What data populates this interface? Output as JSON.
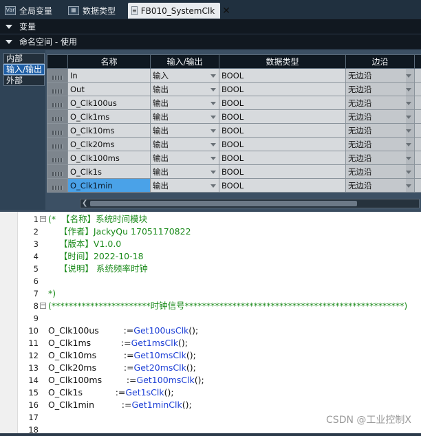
{
  "tabs": [
    {
      "label": "全局变量",
      "icon": "var-icon",
      "icon_text": "Var"
    },
    {
      "label": "数据类型",
      "icon": "data-type-icon",
      "icon_text": "▦"
    },
    {
      "label": "FB010_SystemClk",
      "icon": "fb-icon",
      "icon_text": "≡",
      "active": true
    }
  ],
  "sections": {
    "variables": "变量",
    "namespace": "命名空间 - 使用"
  },
  "scopes": [
    "内部",
    "输入/输出",
    "外部"
  ],
  "table": {
    "headers": [
      "名称",
      "输入/输出",
      "数据类型",
      "边沿"
    ],
    "rows": [
      {
        "name": "In",
        "io": "输入",
        "type": "BOOL",
        "edge": "无边沿"
      },
      {
        "name": "Out",
        "io": "输出",
        "type": "BOOL",
        "edge": "无边沿"
      },
      {
        "name": "O_Clk100us",
        "io": "输出",
        "type": "BOOL",
        "edge": "无边沿"
      },
      {
        "name": "O_Clk1ms",
        "io": "输出",
        "type": "BOOL",
        "edge": "无边沿"
      },
      {
        "name": "O_Clk10ms",
        "io": "输出",
        "type": "BOOL",
        "edge": "无边沿"
      },
      {
        "name": "O_Clk20ms",
        "io": "输出",
        "type": "BOOL",
        "edge": "无边沿"
      },
      {
        "name": "O_Clk100ms",
        "io": "输出",
        "type": "BOOL",
        "edge": "无边沿"
      },
      {
        "name": "O_Clk1s",
        "io": "输出",
        "type": "BOOL",
        "edge": "无边沿"
      },
      {
        "name": "O_Clk1min",
        "io": "输出",
        "type": "BOOL",
        "edge": "无边沿",
        "selected": true
      }
    ]
  },
  "code": {
    "lines": [
      {
        "n": "1",
        "fold": "−",
        "parts": [
          {
            "c": "cmt",
            "t": "(*  【名称】系统时间模块"
          }
        ]
      },
      {
        "n": "2",
        "parts": [
          {
            "c": "cmt",
            "t": "    【作者】JackyQu 17051170822"
          }
        ]
      },
      {
        "n": "3",
        "parts": [
          {
            "c": "cmt",
            "t": "    【版本】V1.0.0"
          }
        ]
      },
      {
        "n": "4",
        "parts": [
          {
            "c": "cmt",
            "t": "    【时间】2022-10-18"
          }
        ]
      },
      {
        "n": "5",
        "parts": [
          {
            "c": "cmt",
            "t": "    【说明】 系统频率时钟"
          }
        ]
      },
      {
        "n": "6",
        "parts": []
      },
      {
        "n": "7",
        "parts": [
          {
            "c": "cmt",
            "t": "*)"
          }
        ]
      },
      {
        "n": "8",
        "fold": "−",
        "parts": [
          {
            "c": "cmt",
            "t": "(***********************时钟信号***************************************************)"
          }
        ]
      },
      {
        "n": "9",
        "parts": []
      },
      {
        "n": "10",
        "parts": [
          {
            "c": "var",
            "t": "O_Clk100us         "
          },
          {
            "c": "op",
            "t": ":="
          },
          {
            "c": "fn",
            "t": "Get100usClk"
          },
          {
            "c": "op",
            "t": "();"
          }
        ]
      },
      {
        "n": "11",
        "parts": [
          {
            "c": "var",
            "t": "O_Clk1ms           "
          },
          {
            "c": "op",
            "t": ":="
          },
          {
            "c": "fn",
            "t": "Get1msClk"
          },
          {
            "c": "op",
            "t": "();"
          }
        ]
      },
      {
        "n": "12",
        "parts": [
          {
            "c": "var",
            "t": "O_Clk10ms          "
          },
          {
            "c": "op",
            "t": ":="
          },
          {
            "c": "fn",
            "t": "Get10msClk"
          },
          {
            "c": "op",
            "t": "();"
          }
        ]
      },
      {
        "n": "13",
        "parts": [
          {
            "c": "var",
            "t": "O_Clk20ms          "
          },
          {
            "c": "op",
            "t": ":="
          },
          {
            "c": "fn",
            "t": "Get20msClk"
          },
          {
            "c": "op",
            "t": "();"
          }
        ]
      },
      {
        "n": "14",
        "parts": [
          {
            "c": "var",
            "t": "O_Clk100ms         "
          },
          {
            "c": "op",
            "t": ":="
          },
          {
            "c": "fn",
            "t": "Get100msClk"
          },
          {
            "c": "op",
            "t": "();"
          }
        ]
      },
      {
        "n": "15",
        "parts": [
          {
            "c": "var",
            "t": "O_Clk1s            "
          },
          {
            "c": "op",
            "t": ":="
          },
          {
            "c": "fn",
            "t": "Get1sClk"
          },
          {
            "c": "op",
            "t": "();"
          }
        ]
      },
      {
        "n": "16",
        "parts": [
          {
            "c": "var",
            "t": "O_Clk1min          "
          },
          {
            "c": "op",
            "t": ":="
          },
          {
            "c": "fn",
            "t": "Get1minClk"
          },
          {
            "c": "op",
            "t": "();"
          }
        ]
      },
      {
        "n": "17",
        "parts": []
      },
      {
        "n": "18",
        "parts": []
      }
    ]
  },
  "watermark": "CSDN @工业控制X",
  "colors": {
    "selection": "#4aa2e8",
    "comment": "#1a8a1a",
    "function": "#1c3fd6"
  }
}
